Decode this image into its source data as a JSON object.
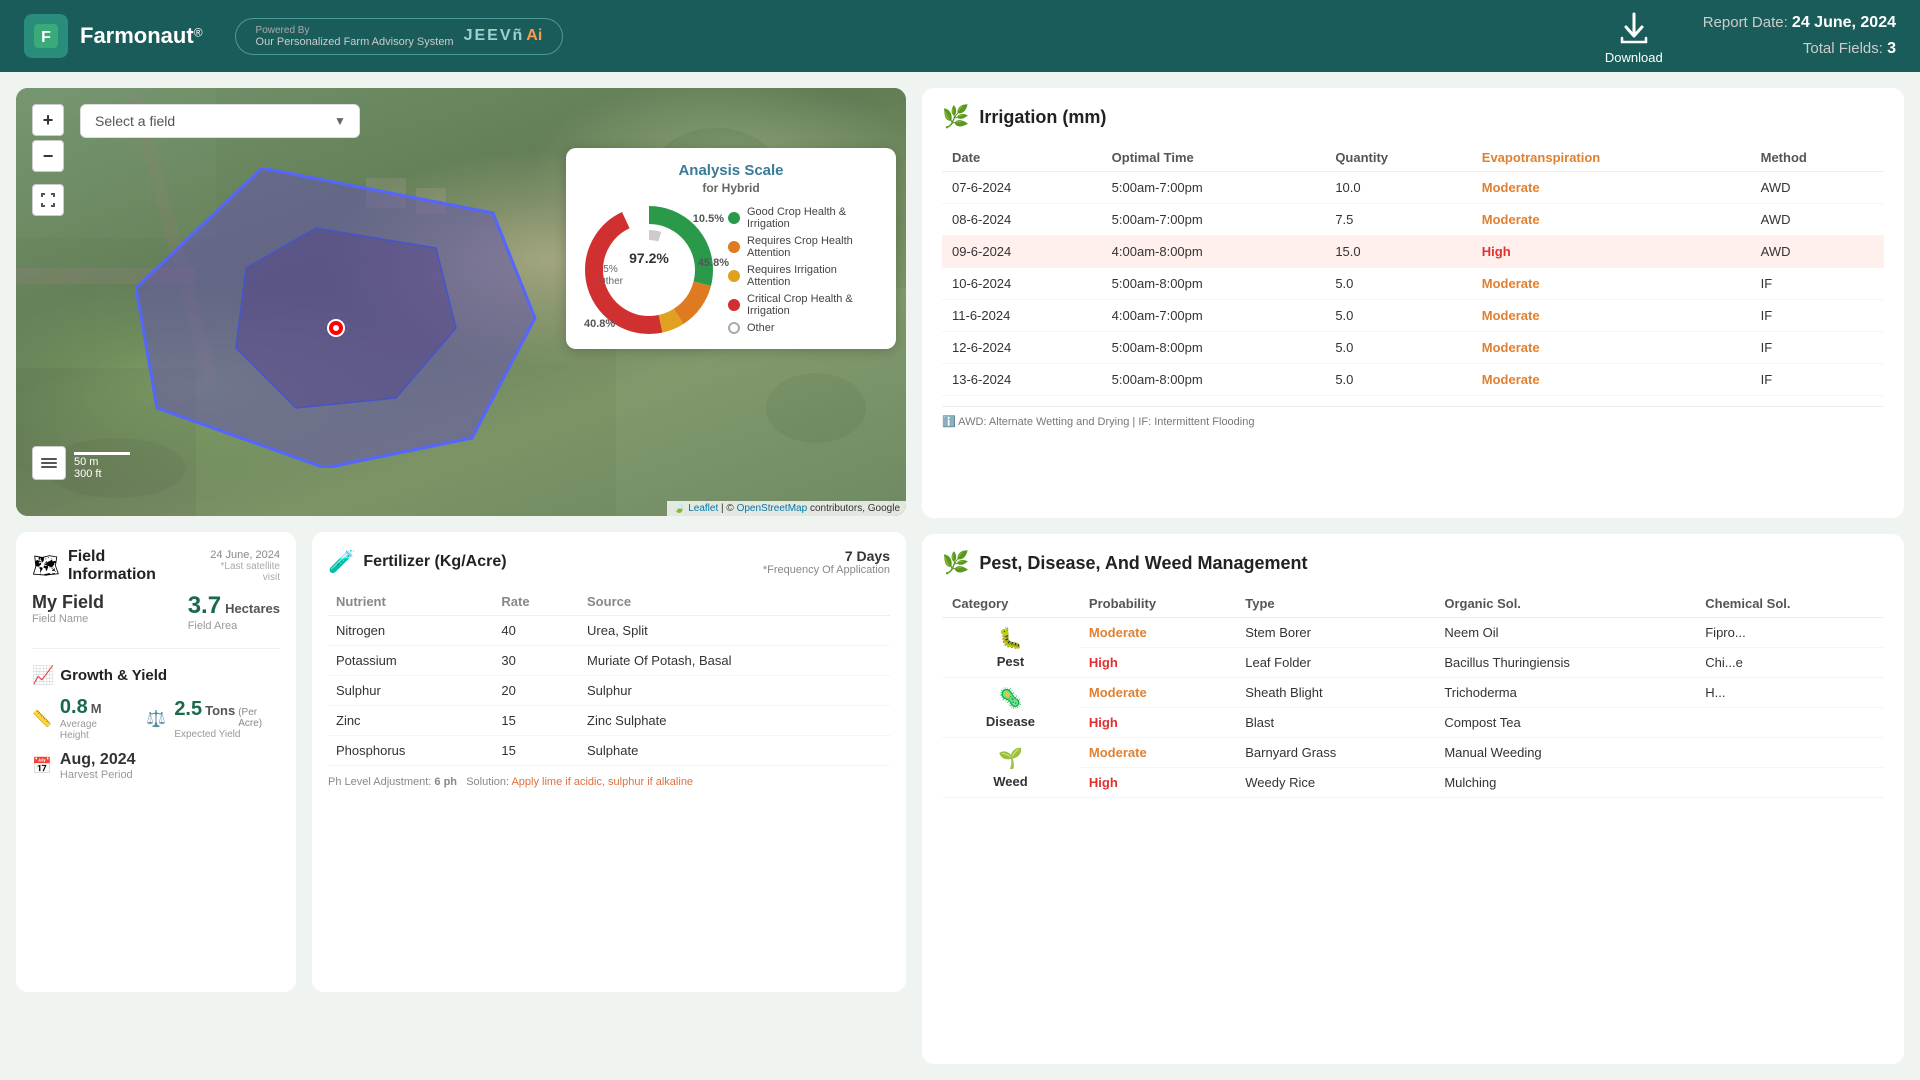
{
  "header": {
    "logo": "F",
    "app_name": "Farmonaut",
    "trademark": "®",
    "jeevn_label": "JEEVñ Ai",
    "powered_by": "Powered By",
    "powered_by_desc": "Our Personalized Farm Advisory System",
    "download_label": "Download",
    "report_date_label": "Report Date:",
    "report_date": "24 June, 2024",
    "total_fields_label": "Total Fields:",
    "total_fields": "3"
  },
  "map": {
    "field_select_placeholder": "Select a field",
    "zoom_in": "+",
    "zoom_out": "−",
    "scale_m": "50 m",
    "scale_ft": "300 ft",
    "attribution": "Leaflet | © OpenStreetMap contributors, Google",
    "leaflet_text": "Leaflet",
    "osm_text": "OpenStreetMap"
  },
  "analysis_scale": {
    "title": "Analysis Scale",
    "subtitle": "for Hybrid",
    "segments": [
      {
        "label": "Good Crop Health & Irrigation",
        "color": "#2a9a4a",
        "value": 45.8
      },
      {
        "label": "Requires Crop Health Attention",
        "color": "#e07a20",
        "value": 10.5
      },
      {
        "label": "Requires Irrigation Attention",
        "color": "#e0a020",
        "value": 5.0
      },
      {
        "label": "Critical Crop Health & Irrigation",
        "color": "#d03030",
        "value": 40.8
      },
      {
        "label": "Other",
        "color": "#aaa",
        "value": 5.0,
        "ring": true
      }
    ],
    "center_label_pct": "97.2%",
    "pct_105": "10.5%",
    "pct_458": "45.8%",
    "pct_408": "40.8%",
    "pct_5_other": "5%\nOther"
  },
  "field_info": {
    "title": "Field Information",
    "icon": "🗺",
    "date": "24 June, 2024",
    "last_sat_visit": "*Last satellite visit",
    "field_name": "My Field",
    "field_name_label": "Field Name",
    "area": "3.7",
    "area_unit": "Hectares",
    "area_label": "Field Area",
    "growth_title": "Growth & Yield",
    "height": "0.8",
    "height_unit": "M",
    "height_label": "Average Height",
    "yield": "2.5",
    "yield_unit": "Tons",
    "yield_per": "(Per Acre)",
    "yield_label": "Expected Yield",
    "harvest_date": "Aug, 2024",
    "harvest_label": "Harvest Period"
  },
  "fertilizer": {
    "title": "Fertilizer (Kg/Acre)",
    "icon": "🧪",
    "freq_days": "7 Days",
    "freq_label": "*Frequency Of Application",
    "col_nutrient": "Nutrient",
    "col_rate": "Rate",
    "col_source": "Source",
    "rows": [
      {
        "nutrient": "Nitrogen",
        "rate": "40",
        "source": "Urea, Split"
      },
      {
        "nutrient": "Potassium",
        "rate": "30",
        "source": "Muriate Of Potash, Basal"
      },
      {
        "nutrient": "Sulphur",
        "rate": "20",
        "source": "Sulphur"
      },
      {
        "nutrient": "Zinc",
        "rate": "15",
        "source": "Zinc Sulphate"
      },
      {
        "nutrient": "Phosphorus",
        "rate": "15",
        "source": "Sulphate"
      }
    ],
    "ph_label": "Ph Level Adjustment:",
    "ph_value": "6 ph",
    "ph_solution_label": "Solution:",
    "ph_solution": "Apply lime if acidic, sulphur if alkaline"
  },
  "irrigation": {
    "title": "Irrigation (mm)",
    "icon": "💧",
    "col_date": "Date",
    "col_optimal": "Optimal Time",
    "col_quantity": "Quantity",
    "col_evap": "Evapotranspiration",
    "col_method": "Method",
    "rows": [
      {
        "date": "07-6-2024",
        "optimal": "5:00am-7:00pm",
        "quantity": "10.0",
        "evap": "Moderate",
        "evap_level": "moderate",
        "method": "AWD",
        "highlight": false
      },
      {
        "date": "08-6-2024",
        "optimal": "5:00am-7:00pm",
        "quantity": "7.5",
        "evap": "Moderate",
        "evap_level": "moderate",
        "method": "AWD",
        "highlight": false
      },
      {
        "date": "09-6-2024",
        "optimal": "4:00am-8:00pm",
        "quantity": "15.0",
        "evap": "High",
        "evap_level": "high",
        "method": "AWD",
        "highlight": true
      },
      {
        "date": "10-6-2024",
        "optimal": "5:00am-8:00pm",
        "quantity": "5.0",
        "evap": "Moderate",
        "evap_level": "moderate",
        "method": "IF",
        "highlight": false
      },
      {
        "date": "11-6-2024",
        "optimal": "4:00am-7:00pm",
        "quantity": "5.0",
        "evap": "Moderate",
        "evap_level": "moderate",
        "method": "IF",
        "highlight": false
      },
      {
        "date": "12-6-2024",
        "optimal": "5:00am-8:00pm",
        "quantity": "5.0",
        "evap": "Moderate",
        "evap_level": "moderate",
        "method": "IF",
        "highlight": false
      },
      {
        "date": "13-6-2024",
        "optimal": "5:00am-8:00pm",
        "quantity": "5.0",
        "evap": "Moderate",
        "evap_level": "moderate",
        "method": "IF",
        "highlight": false
      }
    ],
    "footnote": "AWD: Alternate Wetting and Drying | IF: Intermittent Flooding"
  },
  "pest": {
    "title": "Pest, Disease, And Weed Management",
    "icon": "🌿",
    "col_category": "Category",
    "col_probability": "Probability",
    "col_type": "Type",
    "col_organic": "Organic Sol.",
    "col_chemical": "Chemical Sol.",
    "rows": [
      {
        "category": "Pest",
        "category_icon": "🐛",
        "prob1": "Moderate",
        "prob1_level": "moderate",
        "type1": "Stem Borer",
        "organic1": "Neem Oil",
        "chemical1": "Fipro..."
      },
      {
        "category": "",
        "category_icon": "",
        "prob2": "High",
        "prob2_level": "high",
        "type2": "Leaf Folder",
        "organic2": "Bacillus Thuringiensis",
        "chemical2": "Chi...e"
      },
      {
        "category": "Disease",
        "category_icon": "🦠",
        "prob3": "Moderate",
        "prob3_level": "moderate",
        "type3": "Sheath Blight",
        "organic3": "Trichoderma",
        "chemical3": "H..."
      },
      {
        "category": "",
        "category_icon": "",
        "prob4": "High",
        "prob4_level": "high",
        "type4": "Blast",
        "organic4": "Compost Tea",
        "chemical4": ""
      },
      {
        "category": "Weed",
        "category_icon": "🌱",
        "prob5": "Moderate",
        "prob5_level": "moderate",
        "type5": "Barnyard Grass",
        "organic5": "Manual Weeding",
        "chemical5": ""
      },
      {
        "category": "",
        "category_icon": "",
        "prob6": "High",
        "prob6_level": "high",
        "type6": "Weedy Rice",
        "organic6": "Mulching",
        "chemical6": ""
      }
    ]
  }
}
